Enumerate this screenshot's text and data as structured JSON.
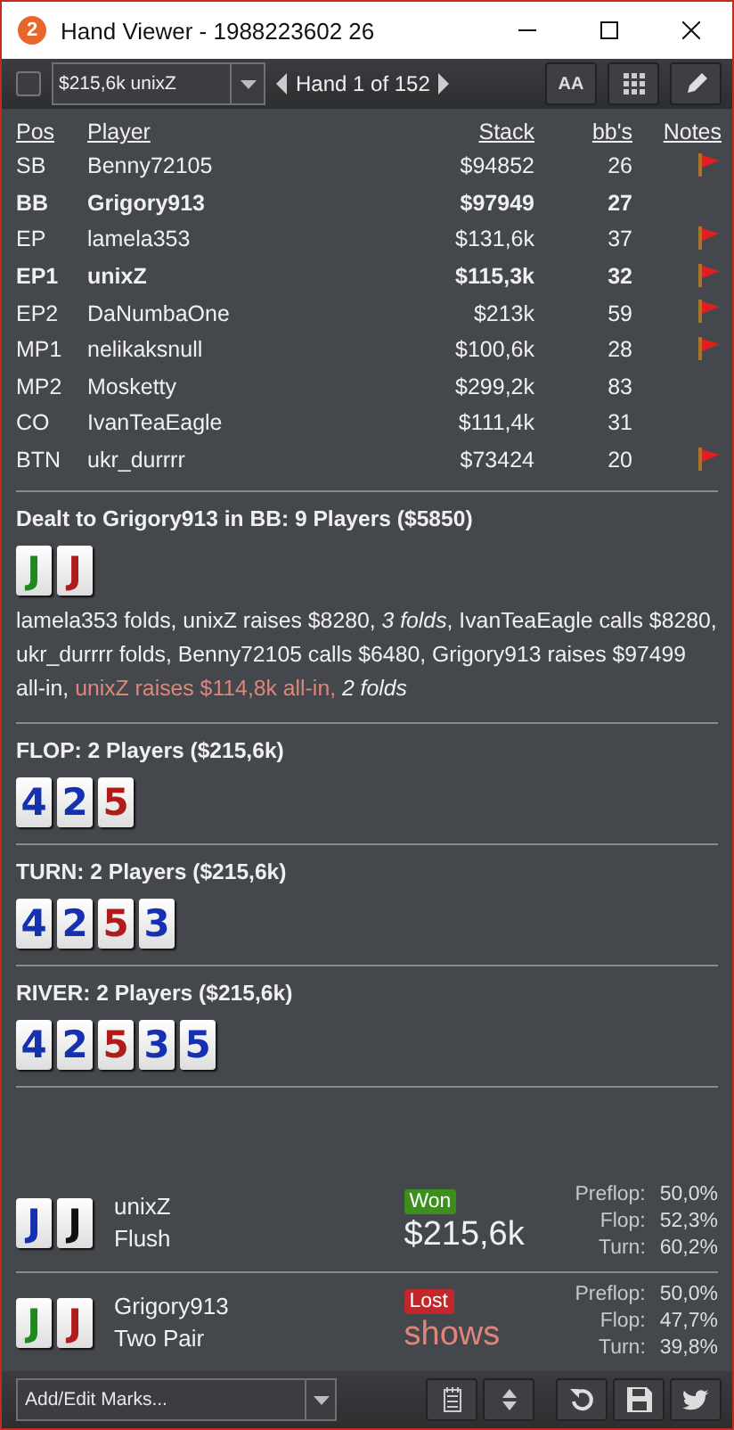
{
  "window": {
    "title": "Hand Viewer - 1988223602 26",
    "badge": "2"
  },
  "toolbar": {
    "checked": false,
    "hand_select": "$215,6k unixZ",
    "hand_label": "Hand 1 of 152",
    "font_button": "AA"
  },
  "table": {
    "columns": [
      "Pos",
      "Player",
      "Stack",
      "bb's",
      "Notes"
    ],
    "rows": [
      {
        "pos": "SB",
        "player": "Benny72105",
        "stack": "$94852",
        "bbs": "26",
        "note": true,
        "bold": false
      },
      {
        "pos": "BB",
        "player": "Grigory913",
        "stack": "$97949",
        "bbs": "27",
        "note": false,
        "bold": true
      },
      {
        "pos": "EP",
        "player": "lamela353",
        "stack": "$131,6k",
        "bbs": "37",
        "note": true,
        "bold": false
      },
      {
        "pos": "EP1",
        "player": "unixZ",
        "stack": "$115,3k",
        "bbs": "32",
        "note": true,
        "bold": true
      },
      {
        "pos": "EP2",
        "player": "DaNumbaOne",
        "stack": "$213k",
        "bbs": "59",
        "note": true,
        "bold": false
      },
      {
        "pos": "MP1",
        "player": "nelikaksnull",
        "stack": "$100,6k",
        "bbs": "28",
        "note": true,
        "bold": false
      },
      {
        "pos": "MP2",
        "player": "Mosketty",
        "stack": "$299,2k",
        "bbs": "83",
        "note": false,
        "bold": false
      },
      {
        "pos": "CO",
        "player": "IvanTeaEagle",
        "stack": "$111,4k",
        "bbs": "31",
        "note": false,
        "bold": false
      },
      {
        "pos": "BTN",
        "player": "ukr_durrrr",
        "stack": "$73424",
        "bbs": "20",
        "note": true,
        "bold": false
      }
    ]
  },
  "streets": [
    {
      "title": "Dealt to Grigory913 in BB: 9 Players ($5850)",
      "cards": [
        {
          "rank": "J",
          "color": "#1e8a1e"
        },
        {
          "rank": "J",
          "color": "#b01c1c"
        }
      ],
      "actions": [
        {
          "kind": "plain",
          "text": "lamela353 folds, unixZ raises $8280, "
        },
        {
          "kind": "italic",
          "text": "3 folds"
        },
        {
          "kind": "plain",
          "text": ", IvanTeaEagle calls $8280, ukr_durrrr folds, Benny72105 calls $6480, Grigory913 raises $97499 all-in, "
        },
        {
          "kind": "highlight",
          "text": "unixZ raises $114,8k all-in, "
        },
        {
          "kind": "italic",
          "text": "2 folds"
        }
      ]
    },
    {
      "title": "FLOP: 2 Players ($215,6k)",
      "cards": [
        {
          "rank": "4",
          "color": "#1530b0"
        },
        {
          "rank": "2",
          "color": "#1530b0"
        },
        {
          "rank": "5",
          "color": "#b01c1c"
        }
      ]
    },
    {
      "title": "TURN: 2 Players ($215,6k)",
      "cards": [
        {
          "rank": "4",
          "color": "#1530b0"
        },
        {
          "rank": "2",
          "color": "#1530b0"
        },
        {
          "rank": "5",
          "color": "#b01c1c"
        },
        {
          "rank": "3",
          "color": "#1530b0"
        }
      ]
    },
    {
      "title": "RIVER: 2 Players ($215,6k)",
      "cards": [
        {
          "rank": "4",
          "color": "#1530b0"
        },
        {
          "rank": "2",
          "color": "#1530b0"
        },
        {
          "rank": "5",
          "color": "#b01c1c"
        },
        {
          "rank": "3",
          "color": "#1530b0"
        },
        {
          "rank": "5",
          "color": "#1530b0"
        }
      ]
    }
  ],
  "results": [
    {
      "cards": [
        {
          "rank": "J",
          "color": "#1530b0"
        },
        {
          "rank": "J",
          "color": "#111111"
        }
      ],
      "player": "unixZ",
      "hand": "Flush",
      "kind": "won",
      "badge": "Won",
      "amount": "$215,6k",
      "equity": [
        {
          "label": "Preflop:",
          "value": "50,0%"
        },
        {
          "label": "Flop:",
          "value": "52,3%"
        },
        {
          "label": "Turn:",
          "value": "60,2%"
        }
      ]
    },
    {
      "cards": [
        {
          "rank": "J",
          "color": "#1e8a1e"
        },
        {
          "rank": "J",
          "color": "#b01c1c"
        }
      ],
      "player": "Grigory913",
      "hand": "Two Pair",
      "kind": "lost",
      "badge": "Lost",
      "amount": "shows",
      "equity": [
        {
          "label": "Preflop:",
          "value": "50,0%"
        },
        {
          "label": "Flop:",
          "value": "47,7%"
        },
        {
          "label": "Turn:",
          "value": "39,8%"
        }
      ]
    }
  ],
  "footer": {
    "marks_placeholder": "Add/Edit Marks..."
  }
}
